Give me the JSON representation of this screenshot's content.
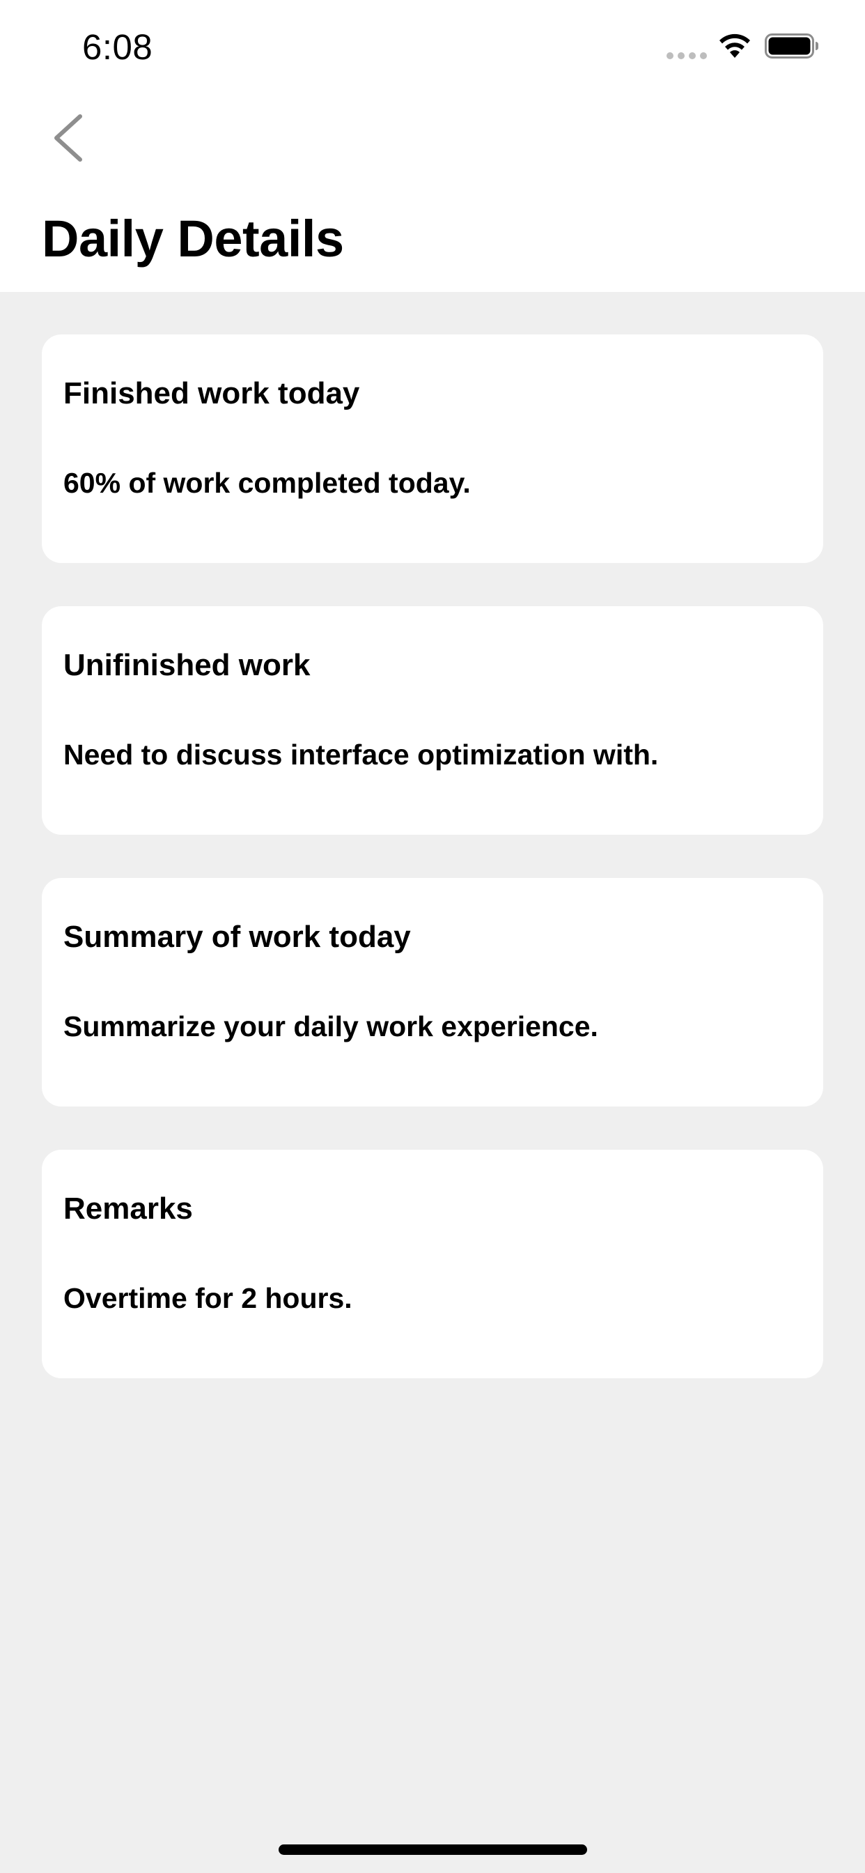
{
  "status_bar": {
    "time": "6:08"
  },
  "nav": {
    "back_icon": "chevron-left-icon",
    "title": "Daily Details"
  },
  "cards": [
    {
      "title": "Finished work today",
      "body": "60% of work completed today."
    },
    {
      "title": "Unifinished work",
      "body": "Need to discuss interface optimization with."
    },
    {
      "title": "Summary of work today",
      "body": "Summarize your daily work experience."
    },
    {
      "title": "Remarks",
      "body": "Overtime for 2 hours."
    }
  ],
  "colors": {
    "background": "#efefef",
    "card": "#ffffff",
    "text": "#000000",
    "back_icon": "#8e8e8e"
  }
}
